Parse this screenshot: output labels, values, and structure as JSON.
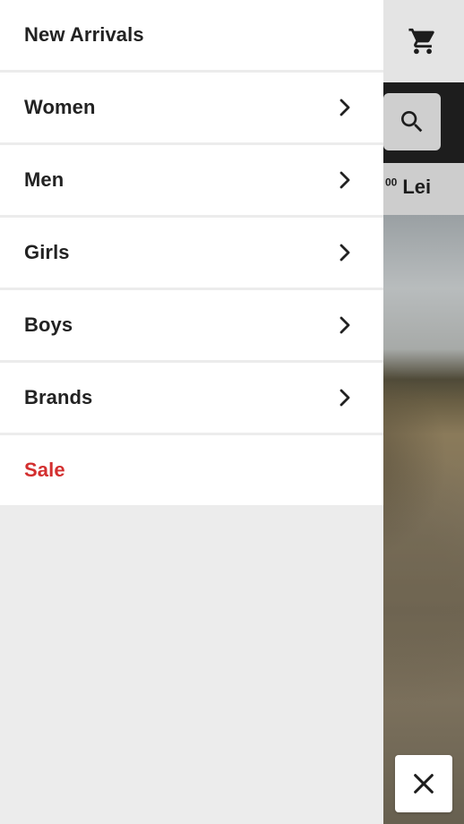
{
  "background_app": {
    "cart_icon": "shopping-cart-icon",
    "search_icon": "search-icon",
    "price": {
      "superscript": "00",
      "currency": "Lei"
    }
  },
  "menu": {
    "items": [
      {
        "label": "New Arrivals",
        "has_chevron": false,
        "style": "normal"
      },
      {
        "label": "Women",
        "has_chevron": true,
        "style": "normal"
      },
      {
        "label": "Men",
        "has_chevron": true,
        "style": "normal"
      },
      {
        "label": "Girls",
        "has_chevron": true,
        "style": "normal"
      },
      {
        "label": "Boys",
        "has_chevron": true,
        "style": "normal"
      },
      {
        "label": "Brands",
        "has_chevron": true,
        "style": "normal"
      },
      {
        "label": "Sale",
        "has_chevron": false,
        "style": "sale"
      }
    ],
    "chevron_icon": "chevron-right-icon",
    "sale_color": "#d32f2f"
  },
  "close_button": {
    "icon": "close-icon"
  }
}
